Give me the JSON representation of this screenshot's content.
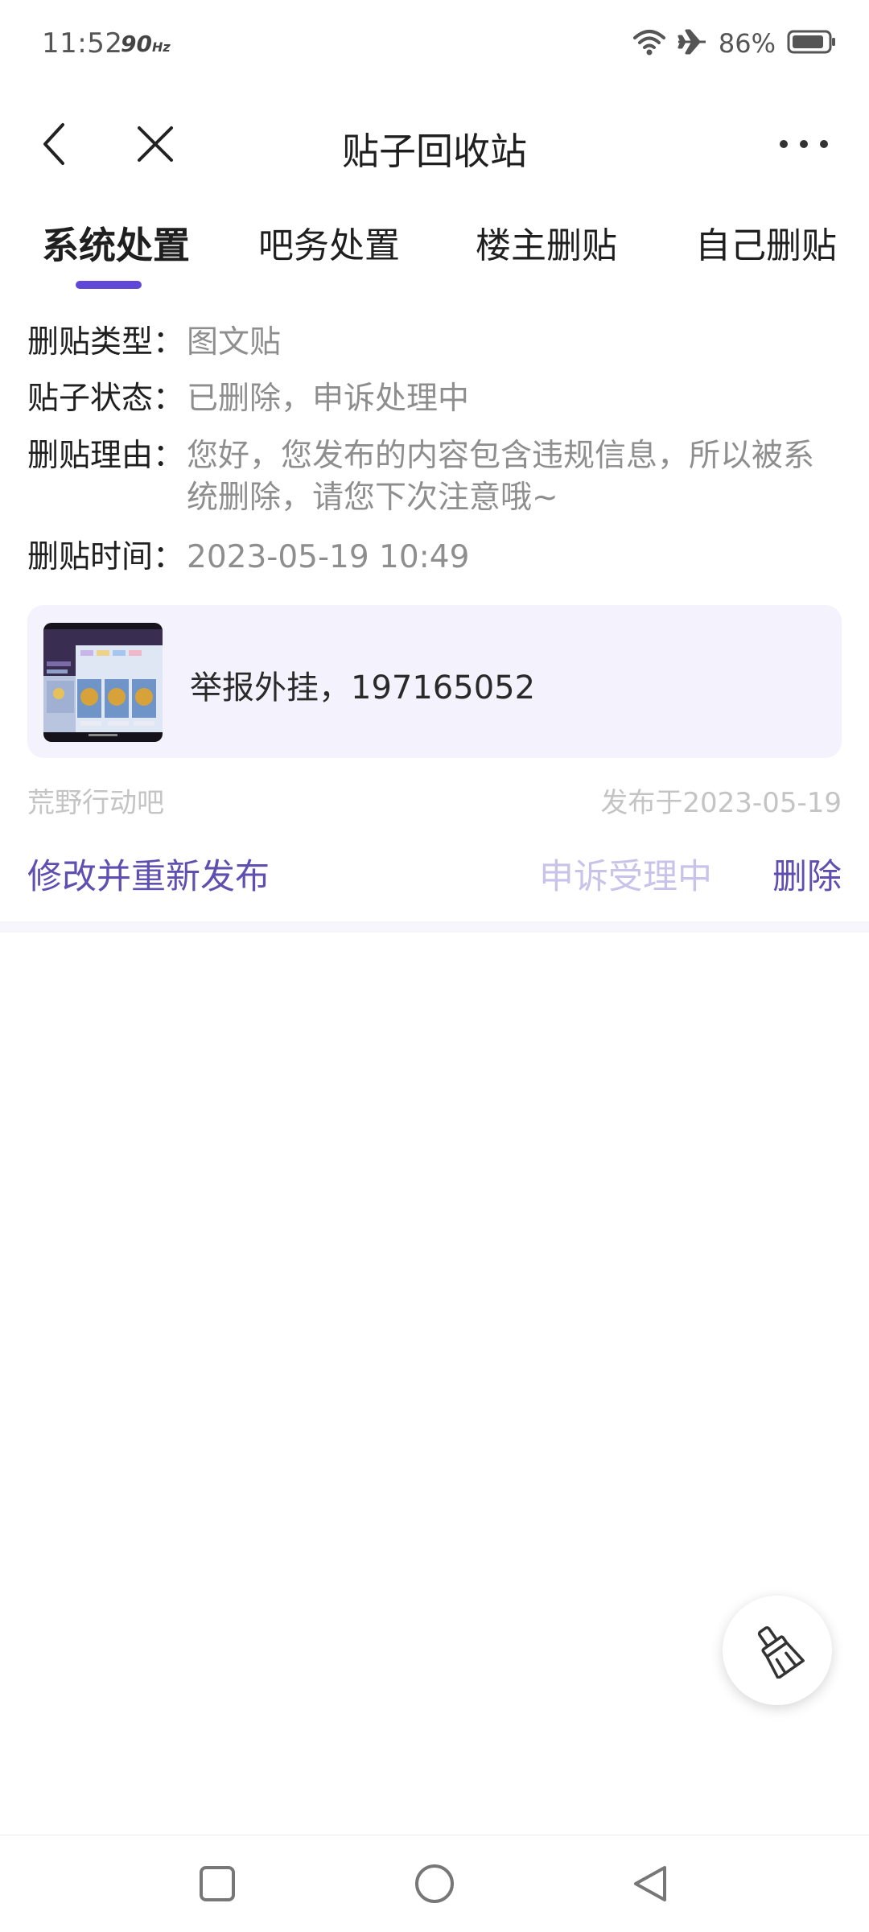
{
  "status_bar": {
    "time": "11:52",
    "refresh_rate": "90",
    "refresh_unit": "Hz",
    "battery_percent": "86%",
    "icons": [
      "wifi-icon",
      "airplane-icon",
      "battery-icon"
    ]
  },
  "header": {
    "title": "贴子回收站",
    "icons": [
      "back-icon",
      "close-icon",
      "more-icon"
    ]
  },
  "tabs": [
    {
      "label": "系统处置",
      "active": true
    },
    {
      "label": "吧务处置",
      "active": false
    },
    {
      "label": "楼主删贴",
      "active": false
    },
    {
      "label": "自己删贴",
      "active": false
    }
  ],
  "details": {
    "type_label": "删贴类型：",
    "type_value": "图文贴",
    "status_label": "贴子状态：",
    "status_value": "已删除，申诉处理中",
    "reason_label": "删贴理由：",
    "reason_value": "您好，您发布的内容包含违规信息，所以被系统删除，请您下次注意哦~",
    "time_label": "删贴时间：",
    "time_value": "2023-05-19 10:49"
  },
  "post": {
    "title": "举报外挂，197165052",
    "forum": "荒野行动吧",
    "published": "发布于2023-05-19",
    "thumbnail": "game-screenshot-thumbnail"
  },
  "actions": {
    "edit_repost": "修改并重新发布",
    "appeal_status": "申诉受理中",
    "delete": "删除"
  },
  "fab": {
    "icon": "broom-icon"
  },
  "system_nav": {
    "icons": [
      "recents-icon",
      "home-icon",
      "back-triangle-icon"
    ]
  },
  "colors": {
    "accent": "#6147d8",
    "action_text": "#5e4fb0",
    "disabled_action": "#c9c3ea",
    "card_background": "#f4f3fd",
    "muted_text": "#8e8e8e"
  }
}
